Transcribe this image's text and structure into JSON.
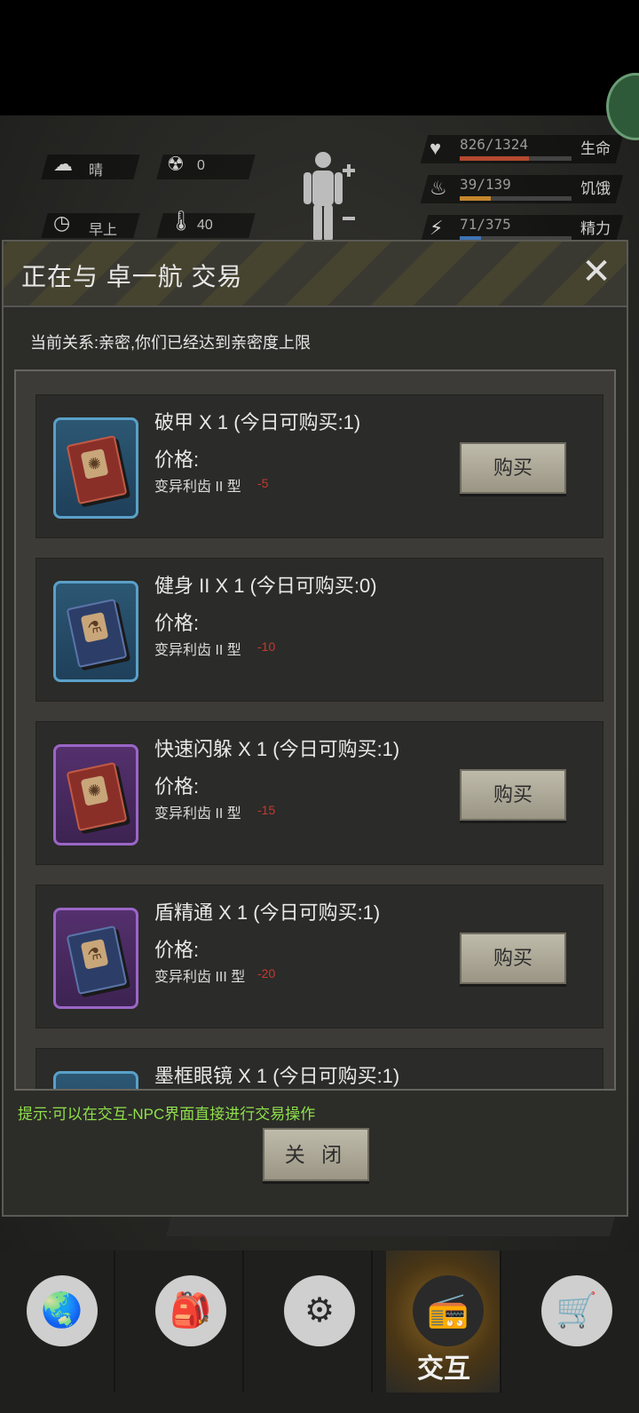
{
  "hud": {
    "weather_label": "晴",
    "radiation_value": "0",
    "time_label": "早上",
    "temperature_value": "40",
    "stats": [
      {
        "value": "826/1324",
        "label": "生命",
        "fill": 0.62,
        "color": "#b4492f"
      },
      {
        "value": "39/139",
        "label": "饥饿",
        "fill": 0.28,
        "color": "#c4862c"
      },
      {
        "value": "71/375",
        "label": "精力",
        "fill": 0.19,
        "color": "#3f74b6"
      }
    ]
  },
  "modal": {
    "title": "正在与 卓一航 交易",
    "relation_text": "当前关系:亲密,你们已经达到亲密度上限",
    "price_label": "价格:",
    "buy_label": "购买",
    "items": [
      {
        "name": "破甲 X 1 (今日可购买:1)",
        "price_item": "变异利齿 II 型",
        "cost": "-5",
        "frame": "blue",
        "book": "red",
        "can_buy": true
      },
      {
        "name": "健身 II X 1 (今日可购买:0)",
        "price_item": "变异利齿 II 型",
        "cost": "-10",
        "frame": "blue",
        "book": "navy",
        "can_buy": false
      },
      {
        "name": "快速闪躲 X 1 (今日可购买:1)",
        "price_item": "变异利齿 II 型",
        "cost": "-15",
        "frame": "purple",
        "book": "red",
        "can_buy": true
      },
      {
        "name": "盾精通 X 1 (今日可购买:1)",
        "price_item": "变异利齿 III 型",
        "cost": "-20",
        "frame": "purple",
        "book": "navy",
        "can_buy": true
      },
      {
        "name": "墨框眼镜 X 1 (今日可购买:1)",
        "price_item": "",
        "cost": "",
        "frame": "blue",
        "book": "red",
        "can_buy": true
      }
    ],
    "tip": "提示:可以在交互-NPC界面直接进行交易操作",
    "close_label": "关 闭"
  },
  "bottom_nav": [
    {
      "icon": "globe-icon",
      "label": ""
    },
    {
      "icon": "backpack-icon",
      "label": ""
    },
    {
      "icon": "head-gears-icon",
      "label": ""
    },
    {
      "icon": "walkie-talkie-icon",
      "label": "交互",
      "active": true
    },
    {
      "icon": "cart-icon",
      "label": ""
    }
  ]
}
